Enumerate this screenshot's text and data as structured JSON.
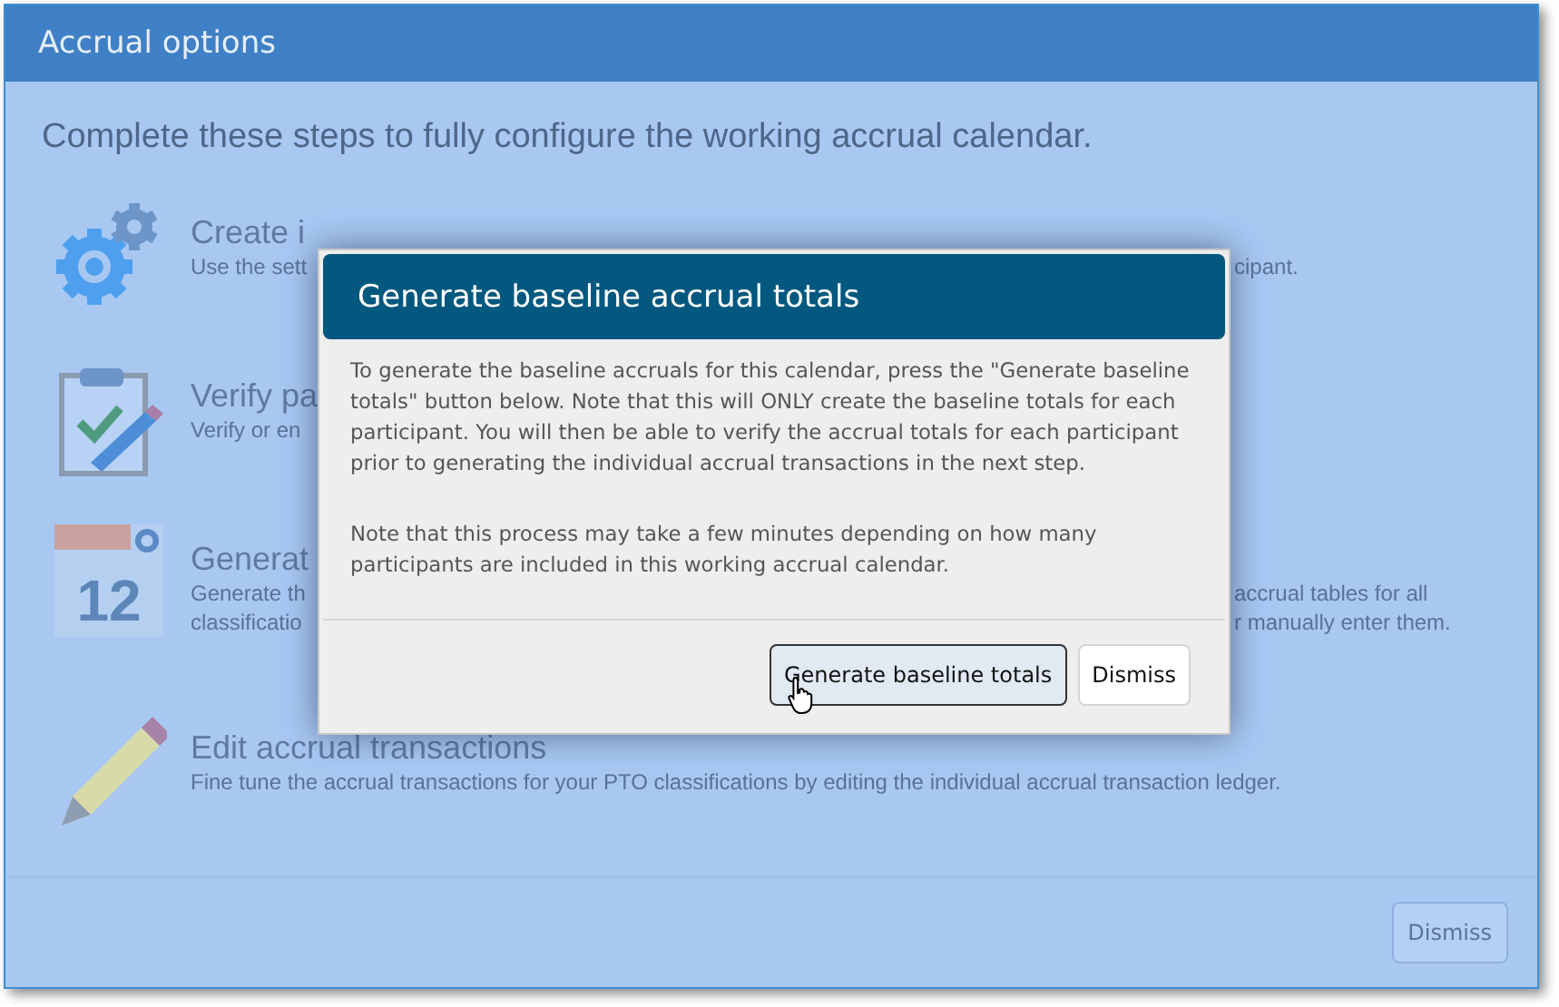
{
  "window": {
    "title": "Accrual options"
  },
  "intro": "Complete these steps to fully configure the working accrual calendar.",
  "steps": [
    {
      "kind": "gears",
      "title": "Create i",
      "lines": [
        {
          "left": "Use the sett",
          "right": "cipant."
        }
      ]
    },
    {
      "kind": "clipboard",
      "title": "Verify pa",
      "lines": [
        {
          "left": "Verify or en"
        }
      ]
    },
    {
      "kind": "calendar",
      "badge": "12",
      "title": "Generat",
      "lines": [
        {
          "left": "Generate th",
          "right": "accrual tables for all"
        },
        {
          "left": "classificatio",
          "right": "r manually enter them."
        }
      ]
    },
    {
      "kind": "pencil",
      "title": "Edit accrual transactions",
      "lines": [
        {
          "left": "Fine tune the accrual transactions for your PTO classifications by editing the individual accrual transaction ledger."
        }
      ]
    }
  ],
  "footer_button": "Dismiss",
  "dialog": {
    "title": "Generate baseline accrual totals",
    "paragraphs": [
      "To generate the baseline accruals for this calendar, press the \"Generate baseline totals\" button below. Note that this will ONLY create the baseline totals for each participant. You will then be able to verify the accrual totals for each participant prior to generating the individual accrual transactions in the next step.",
      "Note that this process may take a few minutes depending on how many participants are included in this working accrual calendar."
    ],
    "buttons": [
      {
        "label": "Generate baseline totals",
        "primary": true,
        "hovered": true
      },
      {
        "label": "Dismiss",
        "primary": false,
        "hovered": false
      }
    ]
  }
}
